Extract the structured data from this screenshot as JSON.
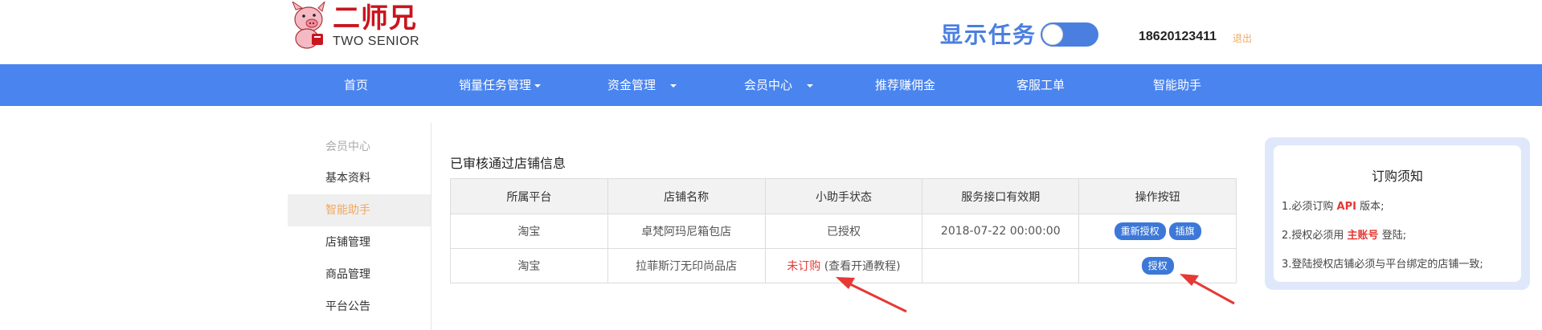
{
  "header": {
    "logo_cn": "二师兄",
    "logo_en": "TWO SENIOR",
    "task_label": "显示任务",
    "phone": "18620123411",
    "logout": "退出",
    "toggle_on": true
  },
  "nav": {
    "items": [
      {
        "label": "首页",
        "dropdown": false
      },
      {
        "label": "销量任务管理",
        "dropdown": true
      },
      {
        "label": "资金管理",
        "dropdown": true
      },
      {
        "label": "会员中心",
        "dropdown": true
      },
      {
        "label": "推荐赚佣金",
        "dropdown": false
      },
      {
        "label": "客服工单",
        "dropdown": false
      },
      {
        "label": "智能助手",
        "dropdown": false
      }
    ]
  },
  "sidebar": {
    "header": "会员中心",
    "items": [
      {
        "label": "基本资料"
      },
      {
        "label": "智能助手",
        "active": true
      },
      {
        "label": "店铺管理"
      },
      {
        "label": "商品管理"
      },
      {
        "label": "平台公告"
      }
    ]
  },
  "main": {
    "title": "已审核通过店铺信息",
    "columns": [
      "所属平台",
      "店铺名称",
      "小助手状态",
      "服务接口有效期",
      "操作按钮"
    ],
    "rows": [
      {
        "platform": "淘宝",
        "shop": "卓梵阿玛尼箱包店",
        "status": "已授权",
        "expiry": "2018-07-22 00:00:00",
        "buttons": [
          "重新授权",
          "插旗"
        ]
      },
      {
        "platform": "淘宝",
        "shop": "拉菲斯汀无印尚品店",
        "status": "未订购",
        "guide": "(查看开通教程)",
        "expiry": "",
        "buttons": [
          "授权"
        ]
      }
    ]
  },
  "notice": {
    "title": "订购须知",
    "line1_pre": "1.必须订购 ",
    "line1_em": "API",
    "line1_post": " 版本;",
    "line2_pre": "2.授权必须用 ",
    "line2_em": "主账号",
    "line2_post": " 登陆;",
    "line3": "3.登陆授权店铺必须与平台绑定的店铺一致;"
  },
  "colors": {
    "brand_red": "#c9151e",
    "nav_blue": "#4a84ef",
    "accent_orange": "#f0a860",
    "button_blue": "#3c78d8",
    "status_green": "#3c9a3c",
    "status_red": "#e53935"
  }
}
